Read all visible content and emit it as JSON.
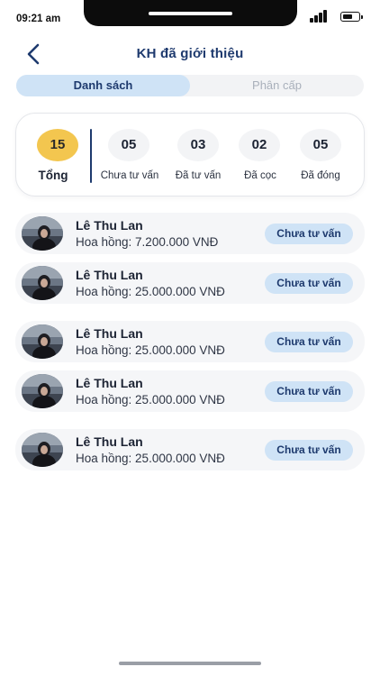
{
  "status_bar": {
    "time": "09:21 am"
  },
  "header": {
    "title": "KH đã giới thiệu",
    "back_icon": "chevron-left-icon"
  },
  "tabs": [
    {
      "label": "Danh sách",
      "active": true
    },
    {
      "label": "Phân cấp",
      "active": false
    }
  ],
  "stats": [
    {
      "value": "15",
      "label": "Tổng",
      "highlight_color": "#f3c64f"
    },
    {
      "value": "05",
      "label": "Chưa tư vấn"
    },
    {
      "value": "03",
      "label": "Đã tư vấn"
    },
    {
      "value": "02",
      "label": "Đã cọc"
    },
    {
      "value": "05",
      "label": "Đã đóng"
    }
  ],
  "customers": [
    {
      "name": "Lê Thu Lan",
      "commission": "Hoa hồng: 7.200.000 VNĐ",
      "status": "Chưa tư vấn"
    },
    {
      "name": "Lê Thu Lan",
      "commission": "Hoa hồng: 25.000.000 VNĐ",
      "status": "Chưa tư vấn"
    },
    {
      "name": "Lê Thu Lan",
      "commission": "Hoa hồng: 25.000.000 VNĐ",
      "status": "Chưa tư vấn"
    },
    {
      "name": "Lê Thu Lan",
      "commission": "Hoa hồng: 25.000.000 VNĐ",
      "status": "Chưa tư vấn"
    },
    {
      "name": "Lê Thu Lan",
      "commission": "Hoa hồng: 25.000.000 VNĐ",
      "status": "Chưa tư vấn"
    }
  ],
  "colors": {
    "accent": "#1e3a6e",
    "badge_bg": "#cfe3f6",
    "total_highlight": "#f3c64f"
  }
}
